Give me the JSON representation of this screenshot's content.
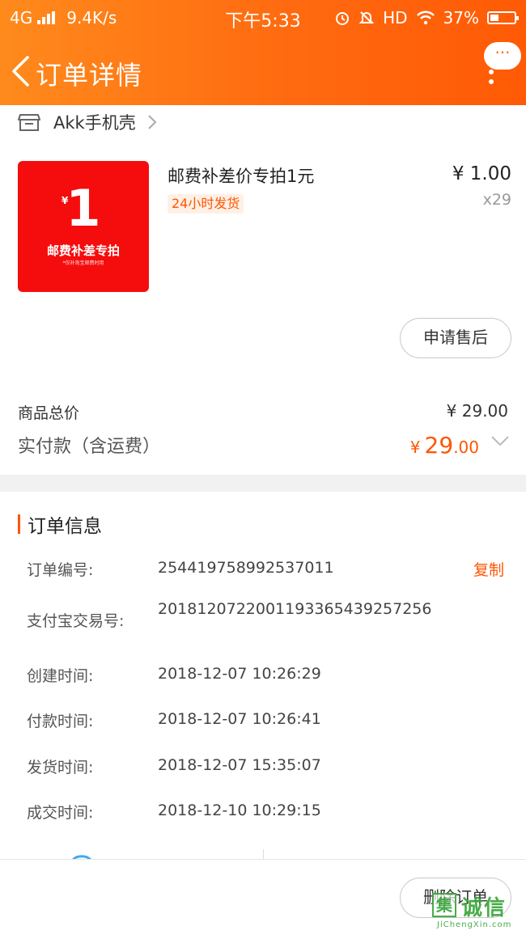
{
  "status_bar": {
    "network": "4G",
    "speed": "9.4K/s",
    "time": "下午5:33",
    "hd": "HD",
    "battery": "37%",
    "battery_level": 0.37
  },
  "nav": {
    "title": "订单详情",
    "chat_icon": "chat-bubble-icon",
    "more_icon": "more-vertical-icon"
  },
  "shop": {
    "name": "Akk手机壳",
    "icon": "store-icon"
  },
  "product": {
    "image": {
      "yen": "¥",
      "number": "1",
      "label": "邮费补差专拍",
      "sub": "*仅补淘宝邮费时用"
    },
    "title": "邮费补差价专拍1元",
    "tag": "24小时发货",
    "price": "¥ 1.00",
    "quantity": "x29",
    "after_sale_button": "申请售后"
  },
  "totals": {
    "total_label": "商品总价",
    "total_value": "¥ 29.00",
    "paid_label": "实付款（含运费）",
    "paid_yen": "¥",
    "paid_int": "29",
    "paid_dec": ".00"
  },
  "order_info": {
    "title": "订单信息",
    "copy_label": "复制",
    "rows": [
      {
        "label": "订单编号:",
        "value": "254419758992537011"
      },
      {
        "label": "支付宝交易号:",
        "value": "2018120722001193365439257256"
      },
      {
        "label": "创建时间:",
        "value": "2018-12-07 10:26:29"
      },
      {
        "label": "付款时间:",
        "value": "2018-12-07 10:26:41"
      },
      {
        "label": "发货时间:",
        "value": "2018-12-07 15:35:07"
      },
      {
        "label": "成交时间:",
        "value": "2018-12-10 10:29:15"
      }
    ]
  },
  "bottom": {
    "delete_button": "删除订单"
  },
  "watermark": {
    "box_char": "集",
    "text": "诚信",
    "url": "JiChengXin.com"
  },
  "colors": {
    "accent": "#ff5500",
    "header_start": "#ff8a1c",
    "header_end": "#ff5a05",
    "product_bg": "#f50d0d",
    "watermark": "#3aa63a"
  }
}
